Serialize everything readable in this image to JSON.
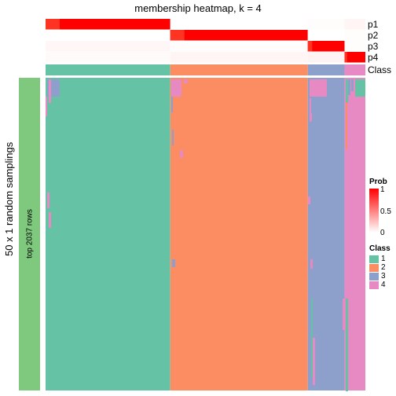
{
  "chart_data": {
    "type": "heatmap",
    "title": "membership heatmap, k = 4",
    "ylabel": "50 x 1 random samplings",
    "row_split_label": "top 2037 rows",
    "top_annotation_rows": [
      "p1",
      "p2",
      "p3",
      "p4",
      "Class"
    ],
    "class_fraction": [
      {
        "class": 1,
        "fraction": 0.39
      },
      {
        "class": 2,
        "fraction": 0.43
      },
      {
        "class": 3,
        "fraction": 0.115
      },
      {
        "class": 4,
        "fraction": 0.065
      }
    ],
    "membership_probabilities": {
      "class_1": {
        "p1": 1.0,
        "p2": 0.0,
        "p3": 0.03,
        "p4": 0.02
      },
      "class_2": {
        "p1": 0.0,
        "p2": 1.0,
        "p3": 0.01,
        "p4": 0.04
      },
      "class_3": {
        "p1": 0.01,
        "p2": 0.0,
        "p3": 1.0,
        "p4": 0.05
      },
      "class_4": {
        "p1": 0.04,
        "p2": 0.01,
        "p3": 0.01,
        "p4": 1.0
      }
    },
    "prob_legend": {
      "title": "Prob",
      "ticks": [
        "1",
        "0.5",
        "0"
      ],
      "range": [
        0,
        1
      ],
      "colors": [
        "#FFFFFF",
        "#FF0000"
      ]
    },
    "class_legend": {
      "title": "Class",
      "items": [
        {
          "label": "1",
          "color": "#66C2A5"
        },
        {
          "label": "2",
          "color": "#FC8D62"
        },
        {
          "label": "3",
          "color": "#8DA0CB"
        },
        {
          "label": "4",
          "color": "#E78AC3"
        }
      ]
    },
    "left_annotation_color": "#7FC97F"
  }
}
